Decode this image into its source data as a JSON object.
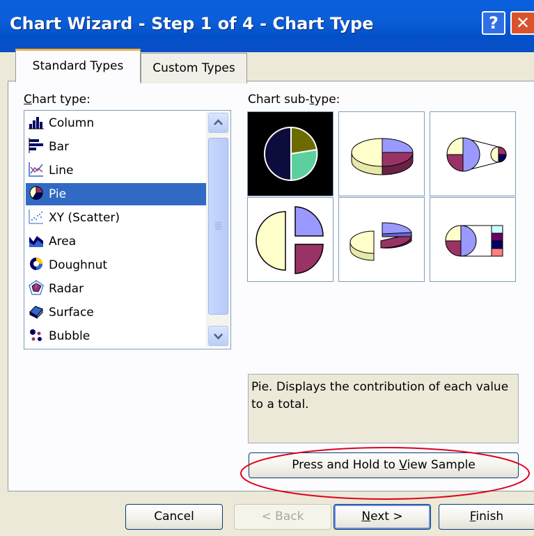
{
  "window": {
    "title": "Chart Wizard - Step 1 of 4 - Chart Type",
    "help_glyph": "?",
    "close_glyph": "✕"
  },
  "tabs": [
    {
      "label": "Standard Types",
      "selected": true
    },
    {
      "label": "Custom Types",
      "selected": false
    }
  ],
  "chart_type": {
    "label_prefix": "C",
    "label_rest": "hart type:",
    "items": [
      {
        "label": "Column",
        "icon": "column-chart-icon"
      },
      {
        "label": "Bar",
        "icon": "bar-chart-icon"
      },
      {
        "label": "Line",
        "icon": "line-chart-icon"
      },
      {
        "label": "Pie",
        "icon": "pie-chart-icon",
        "selected": true
      },
      {
        "label": "XY (Scatter)",
        "icon": "scatter-chart-icon"
      },
      {
        "label": "Area",
        "icon": "area-chart-icon"
      },
      {
        "label": "Doughnut",
        "icon": "doughnut-chart-icon"
      },
      {
        "label": "Radar",
        "icon": "radar-chart-icon"
      },
      {
        "label": "Surface",
        "icon": "surface-chart-icon"
      },
      {
        "label": "Bubble",
        "icon": "bubble-chart-icon"
      }
    ]
  },
  "chart_subtype": {
    "label_before": "Chart sub-",
    "label_ul": "t",
    "label_after": "ype:",
    "items": [
      {
        "icon": "pie-subtype-icon",
        "selected": true
      },
      {
        "icon": "pie-3d-subtype-icon"
      },
      {
        "icon": "pie-of-pie-subtype-icon"
      },
      {
        "icon": "exploded-pie-subtype-icon"
      },
      {
        "icon": "exploded-pie-3d-subtype-icon"
      },
      {
        "icon": "bar-of-pie-subtype-icon"
      }
    ]
  },
  "description": "Pie. Displays the contribution of each value to a total.",
  "buttons": {
    "sample_before": "Press and Hold to ",
    "sample_ul": "V",
    "sample_after": "iew Sample",
    "cancel": "Cancel",
    "back": "< Back",
    "next_ul": "N",
    "next_after": "ext >",
    "finish_ul": "F",
    "finish_after": "inish"
  },
  "colors": {
    "titlebar": "#0a5fdc",
    "selection": "#316ac5",
    "highlight_ellipse": "#e0001b",
    "pie_olive": "#6b6b00",
    "pie_teal": "#5dcf9f",
    "pie_navy": "#0d0d3d",
    "pie_lavender": "#9999ff",
    "pie_maroon": "#993366",
    "pie_cream": "#ffffcc"
  }
}
